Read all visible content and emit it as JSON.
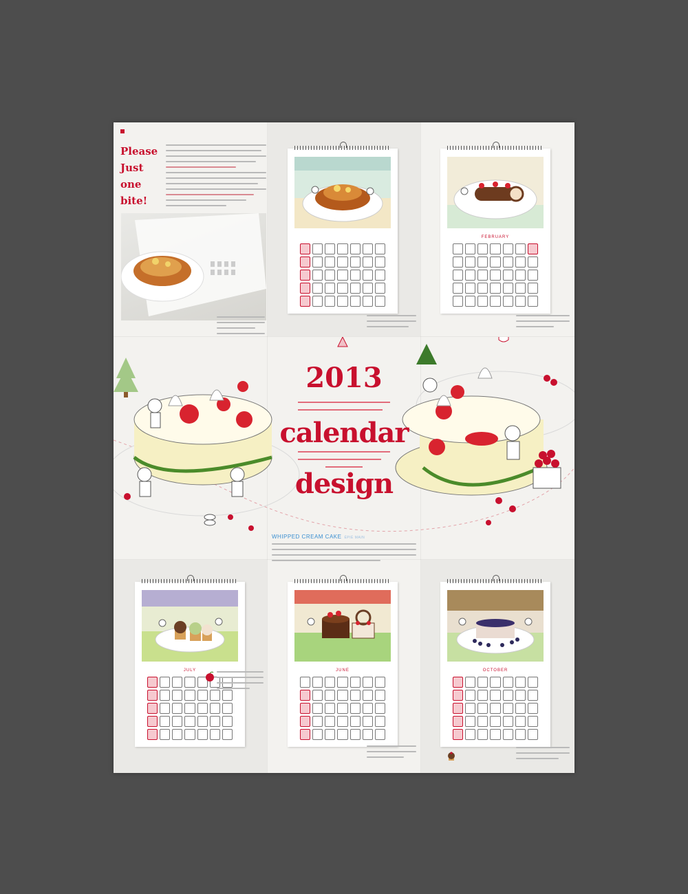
{
  "poster": {
    "background": "#4d4d4d",
    "accent_color": "#c8102e",
    "intro_heading": [
      "Please",
      "Just",
      "one",
      "bite!"
    ],
    "title_year": "2013",
    "title_word1": "calendar",
    "title_word2": "design",
    "section_heading": "WHIPPED CREAM CAKE",
    "section_subheading": "ÉPIÉ MAIN"
  },
  "calendars": [
    {
      "id": "top-middle",
      "month": "",
      "theme": "pancakes"
    },
    {
      "id": "top-right",
      "month": "FEBRUARY",
      "theme": "roll-cake"
    },
    {
      "id": "bottom-left",
      "month": "JULY",
      "theme": "cupcakes"
    },
    {
      "id": "bottom-middle",
      "month": "JUNE",
      "theme": "chocolate-cake"
    },
    {
      "id": "bottom-right",
      "month": "OCTOBER",
      "theme": "blueberry-cake"
    }
  ],
  "icons": [
    "pancake-icon",
    "cake-icon",
    "cherry-icon",
    "tree-icon",
    "party-hat-icon",
    "cupcake-icon",
    "apple-icon",
    "teacup-icon"
  ]
}
